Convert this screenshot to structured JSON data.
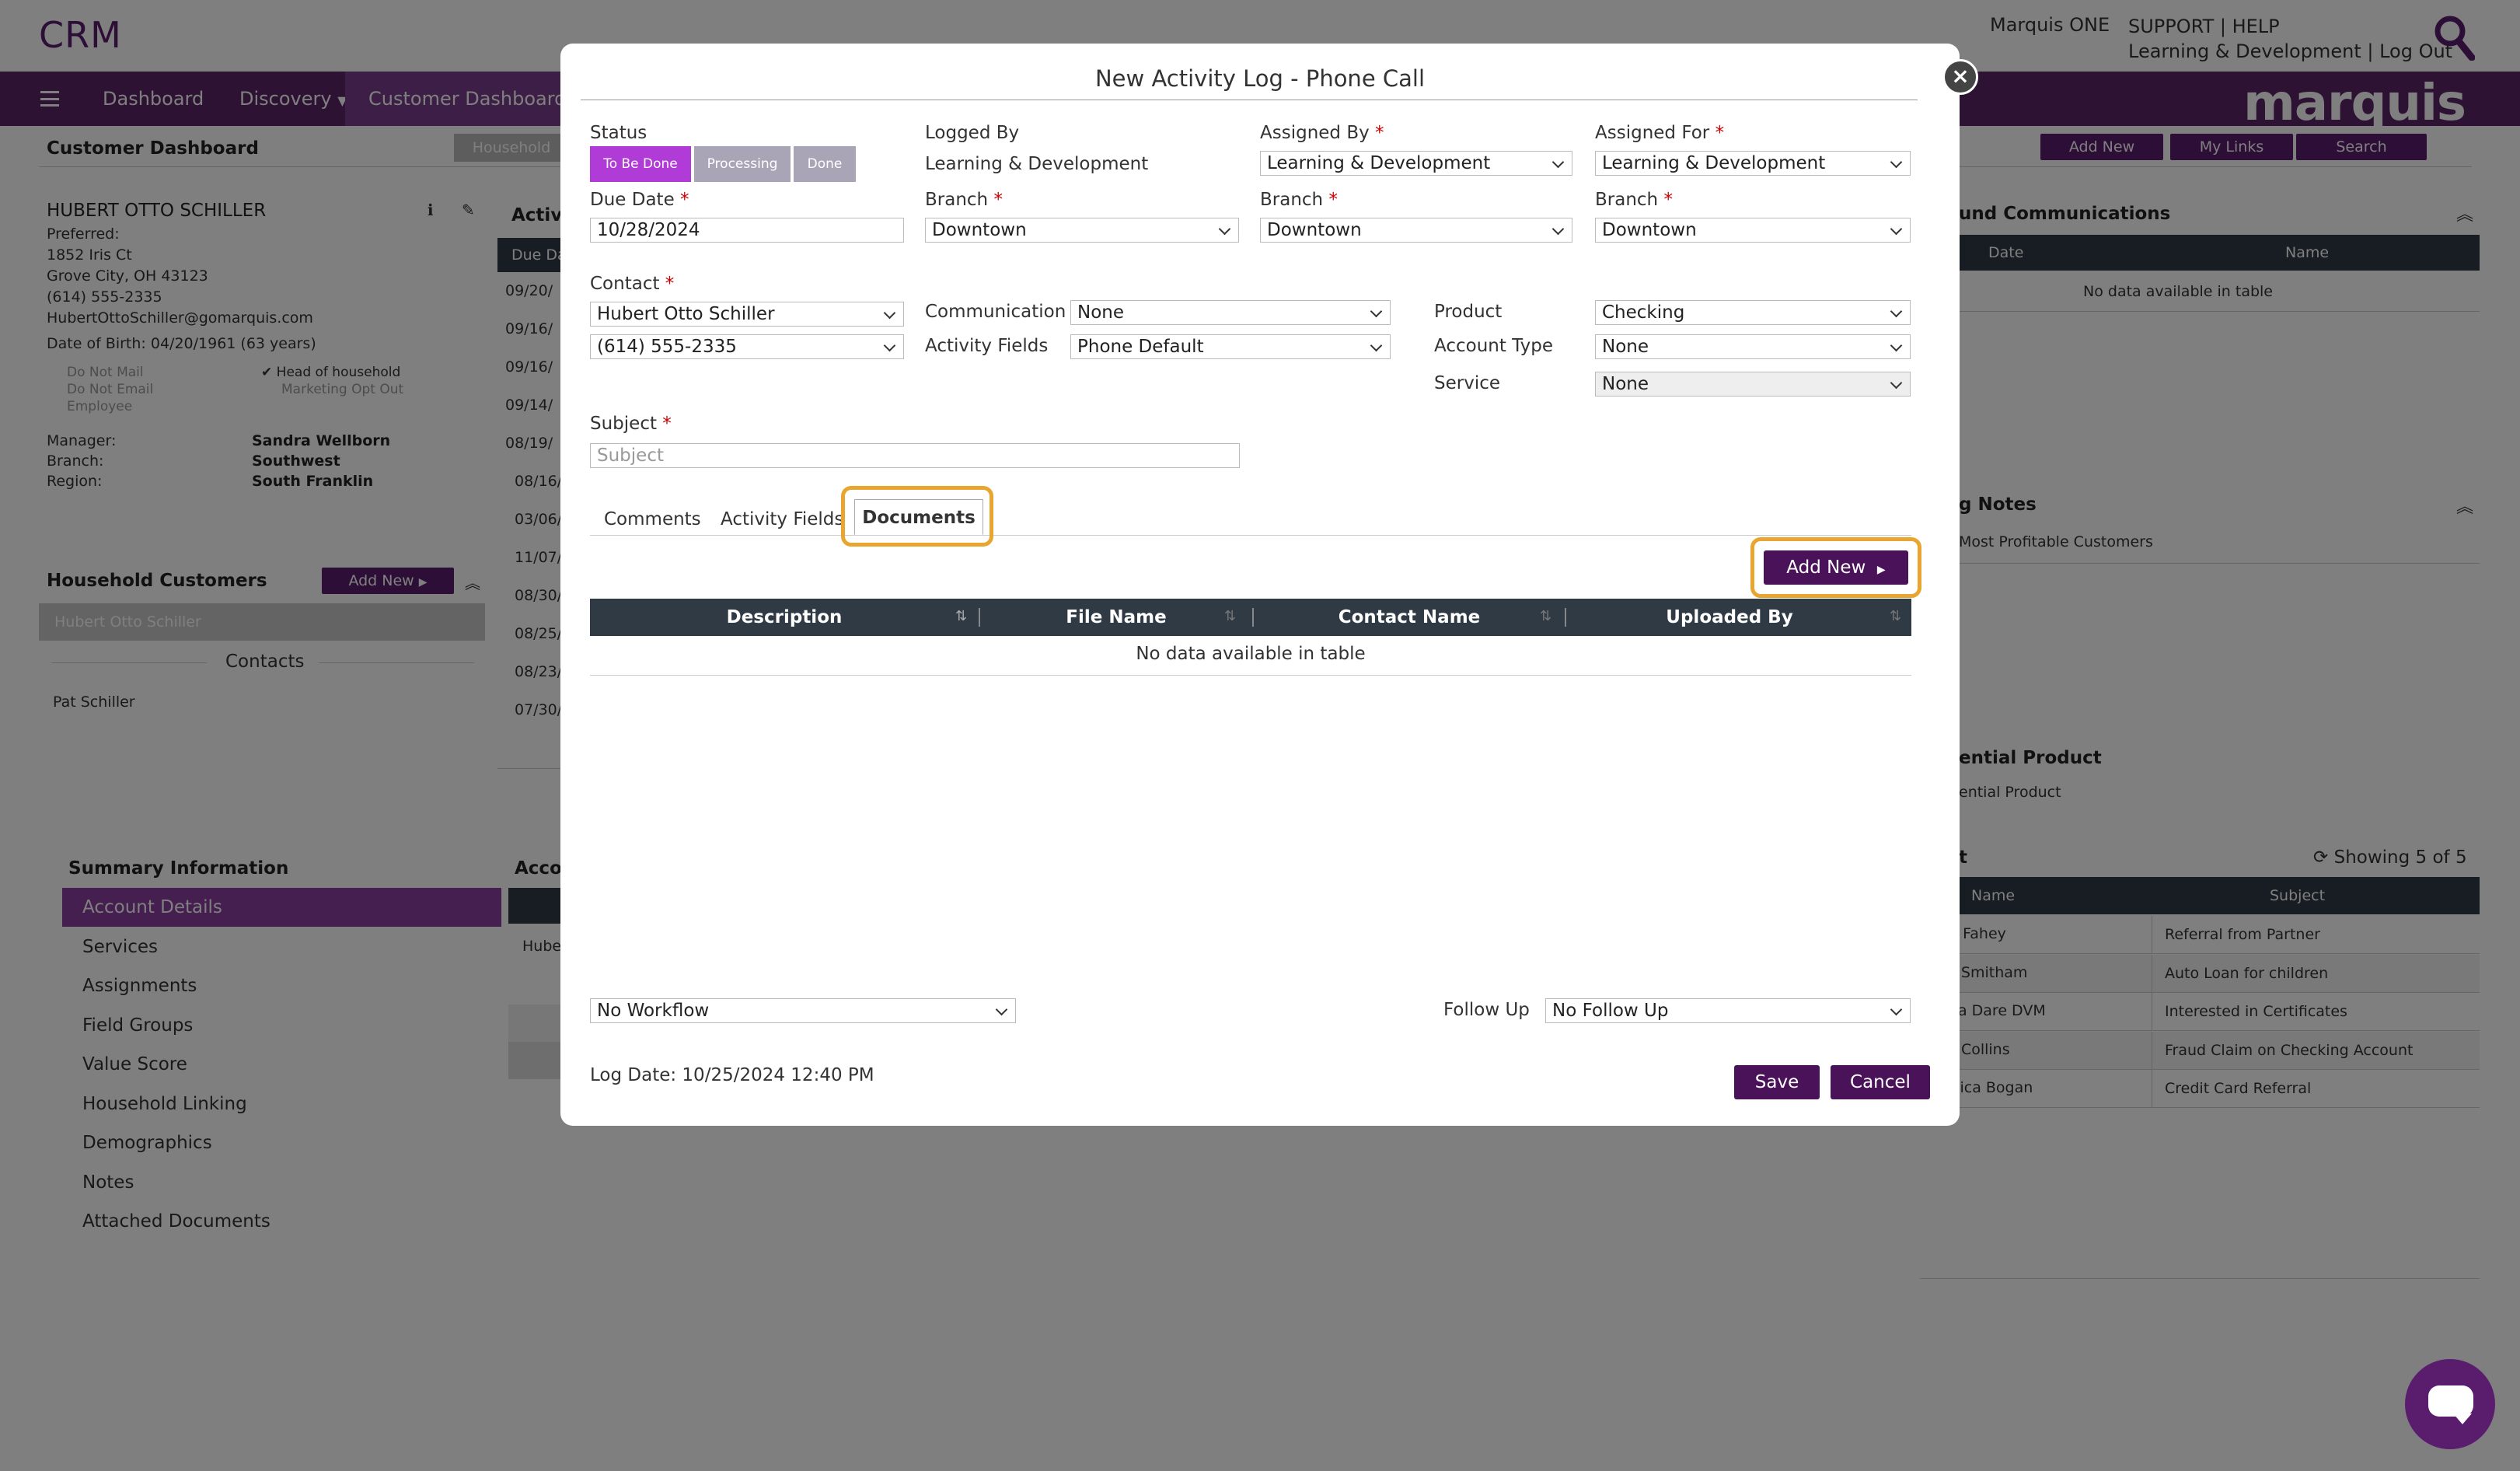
{
  "app": {
    "logo": "CRM",
    "brand": "marquis",
    "user": "Marquis ONE",
    "links_line1": "SUPPORT | HELP",
    "links_line2": "Learning & Development | Log Out"
  },
  "nav": {
    "items": [
      "Dashboard",
      "Discovery",
      "Customer Dashboard"
    ],
    "active": "Customer Dashboard"
  },
  "dashboard": {
    "title": "Customer Dashboard",
    "household_tab": "Household",
    "toolbar": {
      "add_new": "Add New",
      "my_links": "My Links",
      "search": "Search"
    },
    "customer": {
      "name": "HUBERT OTTO SCHILLER",
      "preferred": "Preferred:",
      "address1": "1852 Iris Ct",
      "address2": "Grove City, OH 43123",
      "phone": "(614) 555-2335",
      "email": "HubertOttoSchiller@gomarquis.com",
      "dob": "Date of Birth: 04/20/1961 (63 years)",
      "flags": [
        "Do Not Mail",
        "Do Not Email",
        "Employee"
      ],
      "flags2": [
        "Head of household",
        "Marketing Opt Out"
      ],
      "manager_label": "Manager:",
      "manager": "Sandra Wellborn",
      "branch_label": "Branch:",
      "branch": "Southwest",
      "region_label": "Region:",
      "region": "South Franklin"
    },
    "activities": {
      "title": "Activi",
      "col": "Due Da",
      "dates": [
        "09/20/",
        "09/16/",
        "09/16/",
        "09/14/",
        "08/19/",
        "08/16/",
        "03/06/",
        "11/07/",
        "08/30/",
        "08/25/",
        "08/23/",
        "07/30/"
      ]
    },
    "household": {
      "title": "Household Customers",
      "add_new": "Add New",
      "member": "Hubert Otto Schiller",
      "contacts_label": "Contacts",
      "contact": "Pat Schiller"
    },
    "summary": {
      "title": "Summary Information",
      "items": [
        "Account Details",
        "Services",
        "Assignments",
        "Field Groups",
        "Value Score",
        "Household Linking",
        "Demographics",
        "Notes",
        "Attached Documents"
      ],
      "active": "Account Details"
    },
    "accounts": {
      "title": "Accou",
      "row": "Hube"
    },
    "communications": {
      "title": "und Communications",
      "cols": [
        "Date",
        "Name"
      ],
      "empty": "No data available in table"
    },
    "notes": {
      "title": "g Notes",
      "item": "Most Profitable Customers"
    },
    "potential": {
      "title": "ential Product",
      "item": "ential Product"
    },
    "referrals": {
      "title": "t",
      "showing": "Showing 5 of 5",
      "cols": [
        "Name",
        "Subject"
      ],
      "rows": [
        {
          "name": "bel Fahey",
          "subject": "Referral from Partner"
        },
        {
          "name": "rto Smitham",
          "subject": "Auto Loan for children"
        },
        {
          "name": "iana Dare DVM",
          "subject": "Interested in Certificates"
        },
        {
          "name": "art Collins",
          "subject": "Fraud Claim on Checking Account"
        },
        {
          "name": "essica Bogan",
          "subject": "Credit Card Referral"
        }
      ]
    }
  },
  "modal": {
    "title": "New Activity Log - Phone Call",
    "status": {
      "label": "Status",
      "options": [
        "To Be Done",
        "Processing",
        "Done"
      ],
      "selected": "To Be Done"
    },
    "logged_by": {
      "label": "Logged By",
      "value": "Learning & Development"
    },
    "assigned_by": {
      "label": "Assigned By",
      "value": "Learning & Development"
    },
    "assigned_for": {
      "label": "Assigned For",
      "value": "Learning & Development"
    },
    "due_date": {
      "label": "Due Date",
      "value": "10/28/2024"
    },
    "branch_label": "Branch",
    "branch_logged": "Downtown",
    "branch_assigned_by": "Downtown",
    "branch_assigned_for": "Downtown",
    "contact": {
      "label": "Contact",
      "name": "Hubert Otto Schiller",
      "phone": "(614) 555-2335"
    },
    "communication": {
      "label": "Communication",
      "value": "None"
    },
    "activity_fields": {
      "label": "Activity Fields",
      "value": "Phone Default"
    },
    "product": {
      "label": "Product",
      "value": "Checking"
    },
    "account_type": {
      "label": "Account Type",
      "value": "None"
    },
    "service": {
      "label": "Service",
      "value": "None"
    },
    "subject": {
      "label": "Subject",
      "placeholder": "Subject"
    },
    "tabs": [
      "Comments",
      "Activity Fields",
      "Documents"
    ],
    "active_tab": "Documents",
    "documents": {
      "add_new": "Add New",
      "columns": [
        "Description",
        "File Name",
        "Contact Name",
        "Uploaded By"
      ],
      "empty": "No data available in table"
    },
    "workflow": {
      "value": "No Workflow"
    },
    "follow_up": {
      "label": "Follow Up",
      "value": "No Follow Up"
    },
    "log_date": "Log Date: 10/25/2024 12:40 PM",
    "save": "Save",
    "cancel": "Cancel"
  },
  "colors": {
    "brand": "#5a1d6e",
    "status_active": "#b03bd6",
    "status_inactive": "#a9a5b6",
    "header_dark": "#2f3a45",
    "highlight": "#e8a630"
  }
}
